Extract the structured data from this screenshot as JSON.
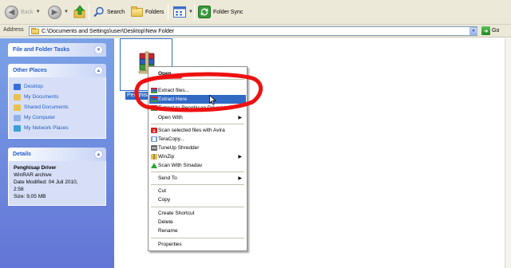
{
  "toolbar": {
    "back_label": "Back",
    "search_label": "Search",
    "folders_label": "Folders",
    "folder_sync_label": "Folder Sync"
  },
  "address": {
    "label": "Address",
    "path": "C:\\Documents and Settings\\user\\Desktop\\New Folder",
    "go_label": "Go"
  },
  "sidebar": {
    "file_folder_tasks": {
      "title": "File and Folder Tasks"
    },
    "other_places": {
      "title": "Other Places",
      "items": [
        {
          "label": "Desktop",
          "icon": "desktop-icon",
          "color": "#3a6fd8"
        },
        {
          "label": "My Documents",
          "icon": "my-documents-icon",
          "color": "#e8c150"
        },
        {
          "label": "Shared Documents",
          "icon": "shared-documents-icon",
          "color": "#e8c150"
        },
        {
          "label": "My Computer",
          "icon": "my-computer-icon",
          "color": "#8fb3e8"
        },
        {
          "label": "My Network Places",
          "icon": "network-places-icon",
          "color": "#3aa0d8"
        }
      ]
    },
    "details": {
      "title": "Details",
      "name": "Penghisap Driver",
      "type": "WinRAR archive",
      "modified_line1": "Date Modified: 04 Juli 2010,",
      "modified_line2": "2:58",
      "size": "Size: 9,05 MB"
    }
  },
  "file": {
    "name": "Penghisap Driver"
  },
  "context_menu": {
    "items": [
      {
        "label": "Open",
        "bold": true
      },
      {
        "label": "Extract files...",
        "icon": "winrar-icon"
      },
      {
        "label": "Extract Here",
        "icon": "winrar-icon",
        "highlighted": true
      },
      {
        "label": "Extract to Penghisap Driver\\",
        "icon": "winrar-icon"
      },
      {
        "label": "Open With",
        "submenu": true
      },
      {
        "label": "Scan selected files with Avira",
        "icon": "avira-icon"
      },
      {
        "label": "TeraCopy...",
        "icon": "teracopy-icon"
      },
      {
        "label": "TuneUp Shredder",
        "icon": "tuneup-icon"
      },
      {
        "label": "WinZip",
        "icon": "winzip-icon",
        "submenu": true
      },
      {
        "label": "Scan With Smadav",
        "icon": "smadav-icon"
      },
      {
        "label": "Send To",
        "submenu": true
      },
      {
        "label": "Cut"
      },
      {
        "label": "Copy"
      },
      {
        "label": "Create Shortcut"
      },
      {
        "label": "Delete"
      },
      {
        "label": "Rename"
      },
      {
        "label": "Properties"
      }
    ]
  },
  "colors": {
    "selection_blue": "#316ac5",
    "sidebar_gradient_top": "#7ba2e7",
    "sidebar_gradient_bottom": "#6375d6",
    "annotation_red": "#ee1111"
  }
}
